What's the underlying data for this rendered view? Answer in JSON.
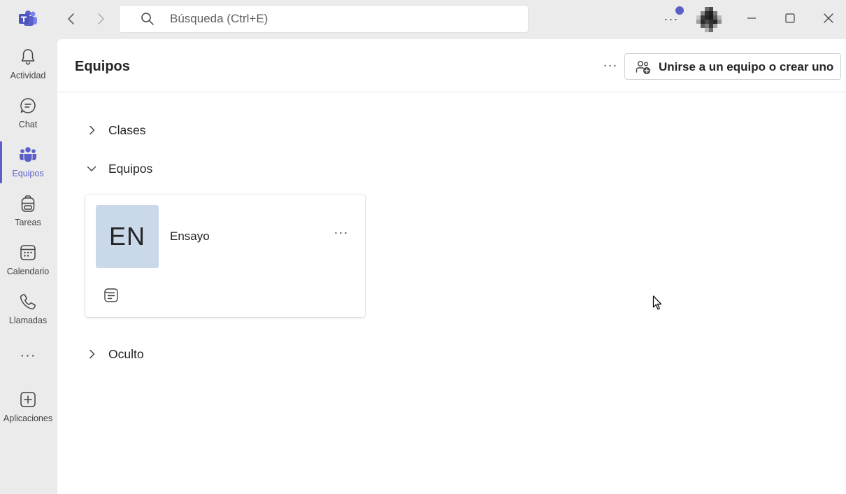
{
  "titlebar": {
    "search_placeholder": "Búsqueda (Ctrl+E)",
    "more_label": "···"
  },
  "rail": {
    "items": [
      {
        "label": "Actividad",
        "icon": "bell-icon",
        "active": false
      },
      {
        "label": "Chat",
        "icon": "chat-icon",
        "active": false
      },
      {
        "label": "Equipos",
        "icon": "teams-icon",
        "active": true
      },
      {
        "label": "Tareas",
        "icon": "backpack-icon",
        "active": false
      },
      {
        "label": "Calendario",
        "icon": "calendar-icon",
        "active": false
      },
      {
        "label": "Llamadas",
        "icon": "phone-icon",
        "active": false
      }
    ],
    "more_label": "···",
    "apps": {
      "label": "Aplicaciones",
      "icon": "add-square-icon"
    }
  },
  "header": {
    "title": "Equipos",
    "more_label": "···",
    "join_button": "Unirse a un equipo o crear uno"
  },
  "sections": {
    "clases": "Clases",
    "equipos": "Equipos",
    "oculto": "Oculto"
  },
  "team": {
    "initials": "EN",
    "name": "Ensayo",
    "more_label": "···"
  },
  "colors": {
    "accent": "#5b5fc7",
    "tile": "#cad9ea",
    "rail_bg": "#ebebeb"
  }
}
